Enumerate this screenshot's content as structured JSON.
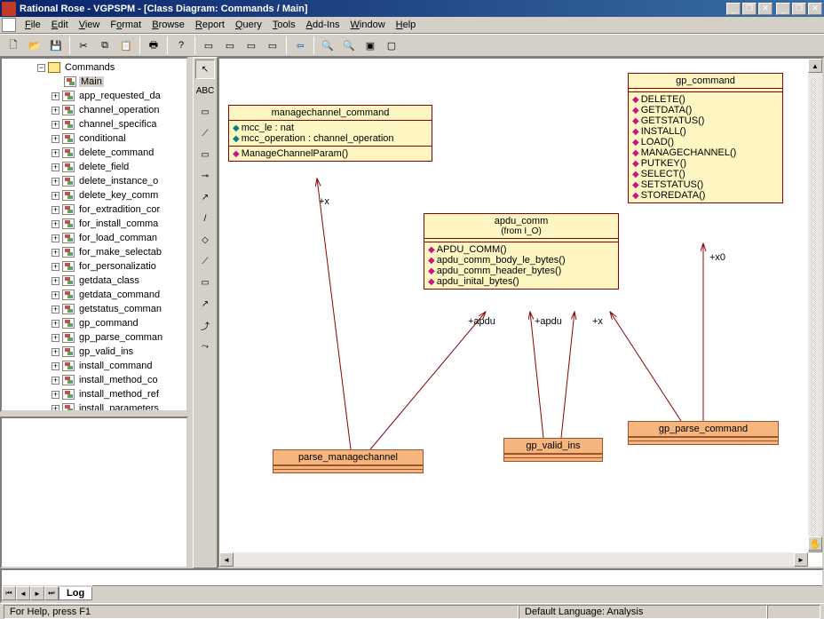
{
  "title": "Rational Rose - VGPSPM - [Class Diagram: Commands / Main]",
  "menus": [
    "File",
    "Edit",
    "View",
    "Format",
    "Browse",
    "Report",
    "Query",
    "Tools",
    "Add-Ins",
    "Window",
    "Help"
  ],
  "tree": {
    "root": "Commands",
    "selected": "Main",
    "items": [
      "app_requested_da",
      "channel_operation",
      "channel_specifica",
      "conditional",
      "delete_command",
      "delete_field",
      "delete_instance_o",
      "delete_key_comm",
      "for_extradition_cor",
      "for_install_comma",
      "for_load_comman",
      "for_make_selectab",
      "for_personalizatio",
      "getdata_class",
      "getdata_command",
      "getstatus_comman",
      "gp_command",
      "gp_parse_comman",
      "gp_valid_ins",
      "install_command",
      "install_method_co",
      "install_method_ref",
      "install_parameters"
    ]
  },
  "classes": {
    "managechannel": {
      "name": "managechannel_command",
      "attrs": [
        "mcc_le : nat",
        "mcc_operation : channel_operation"
      ],
      "ops": [
        "ManageChannelParam()"
      ]
    },
    "apdu": {
      "name": "apdu_comm",
      "from": "(from I_O)",
      "ops": [
        "APDU_COMM()",
        "apdu_comm_body_le_bytes()",
        "apdu_comm_header_bytes()",
        "apdu_inital_bytes()"
      ]
    },
    "gp": {
      "name": "gp_command",
      "ops": [
        "DELETE()",
        "GETDATA()",
        "GETSTATUS()",
        "INSTALL()",
        "LOAD()",
        "MANAGECHANNEL()",
        "PUTKEY()",
        "SELECT()",
        "SETSTATUS()",
        "STOREDATA()"
      ]
    },
    "parse_mc": {
      "name": "parse_managechannel"
    },
    "gp_valid": {
      "name": "gp_valid_ins"
    },
    "gp_parse": {
      "name": "gp_parse_command"
    }
  },
  "assoc_labels": {
    "x1": "+x",
    "apdu1": "+apdu",
    "apdu2": "+apdu",
    "x2": "+x",
    "x0": "+x0"
  },
  "log_tab": "Log",
  "status": {
    "help": "For Help, press F1",
    "lang": "Default Language: Analysis"
  }
}
